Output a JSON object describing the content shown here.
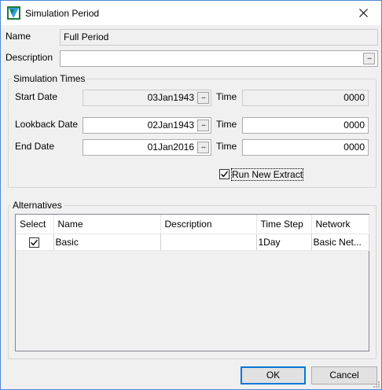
{
  "window": {
    "title": "Simulation Period",
    "close_glyph": "✕",
    "icon": "app-icon"
  },
  "form": {
    "name_label": "Name",
    "name_value": "Full Period",
    "description_label": "Description",
    "description_value": "",
    "ellipsis": "..."
  },
  "sim_times": {
    "group_label": "Simulation Times",
    "start_date_label": "Start Date",
    "start_date_value": "03Jan1943",
    "start_time_label": "Time",
    "start_time_value": "0000",
    "lookback_date_label": "Lookback Date",
    "lookback_date_value": "02Jan1943",
    "lookback_time_label": "Time",
    "lookback_time_value": "0000",
    "end_date_label": "End Date",
    "end_date_value": "01Jan2016",
    "end_time_label": "Time",
    "end_time_value": "0000",
    "run_new_extract_label": "Run New Extract",
    "run_new_extract_checked": true
  },
  "alternatives": {
    "group_label": "Alternatives",
    "columns": [
      "Select",
      "Name",
      "Description",
      "Time Step",
      "Network"
    ],
    "rows": [
      {
        "selected": true,
        "name": "Basic",
        "description": "",
        "time_step": "1Day",
        "network": "Basic Net..."
      }
    ]
  },
  "buttons": {
    "ok": "OK",
    "cancel": "Cancel"
  }
}
